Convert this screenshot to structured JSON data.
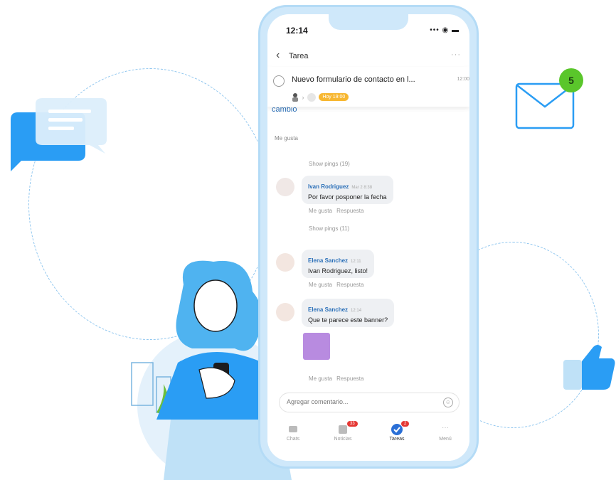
{
  "status_bar": {
    "time": "12:14",
    "icons": "••• ◉ ▬"
  },
  "nav": {
    "back_icon": "‹",
    "title": "Tarea",
    "more_icon": "···"
  },
  "task": {
    "title": "Nuevo formulario de contacto en l...",
    "time": "12:00",
    "badge": "Hoy 19:00"
  },
  "feed": {
    "cut_text": "cambio",
    "like_label": "Me gusta",
    "pings_1": "Show pings (19)",
    "comments": [
      {
        "author": "Ivan Rodriguez",
        "time": "Mar 2 8:38",
        "text": "Por favor posponer la fecha",
        "like": "Me gusta",
        "reply": "Respuesta"
      },
      {
        "author": "Elena Sanchez",
        "time": "12:11",
        "text": "Ivan Rodriguez, listo!",
        "like": "Me gusta",
        "reply": "Respuesta"
      },
      {
        "author": "Elena Sanchez",
        "time": "12:14",
        "text": "Que te parece este banner?",
        "like": "Me gusta",
        "reply": "Respuesta"
      }
    ],
    "pings_2": "Show pings (11)"
  },
  "comment_input": {
    "placeholder": "Agregar comentario..."
  },
  "tabs": [
    {
      "label": "Chats",
      "icon": "chat-icon"
    },
    {
      "label": "Noticias",
      "icon": "news-icon",
      "count": "33"
    },
    {
      "label": "Tareas",
      "icon": "tasks-icon",
      "count": "2"
    },
    {
      "label": "Menú",
      "icon": "menu-icon"
    }
  ],
  "mail": {
    "count": "5"
  },
  "colors": {
    "accent": "#2a9df4",
    "phone_frame": "#cfe8fa",
    "badge": "#f7b731"
  }
}
